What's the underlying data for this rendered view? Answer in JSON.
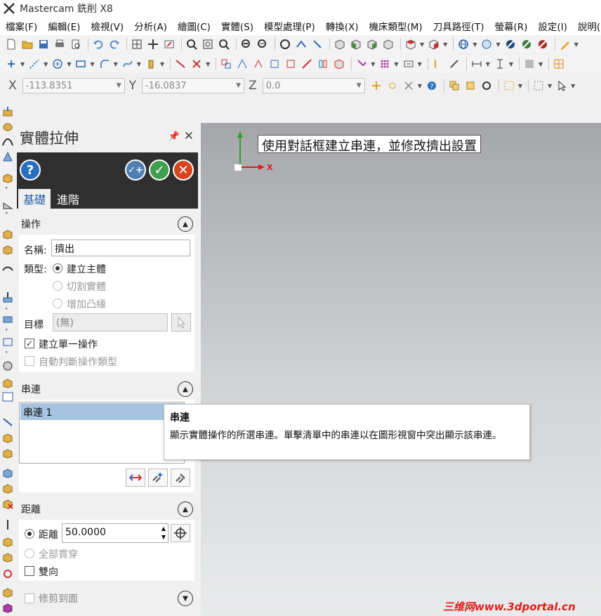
{
  "window": {
    "title": "Mastercam 銑削 X8"
  },
  "menu": [
    "檔案(F)",
    "編輯(E)",
    "檢視(V)",
    "分析(A)",
    "繪圖(C)",
    "實體(S)",
    "模型處理(P)",
    "轉換(X)",
    "機床類型(M)",
    "刀具路徑(T)",
    "螢幕(R)",
    "設定(I)",
    "說明(H)"
  ],
  "coords": {
    "x_label": "X",
    "x_value": "-113.8351",
    "y_label": "Y",
    "y_value": "-16.0837",
    "z_label": "Z",
    "z_value": "0.0"
  },
  "panel": {
    "title": "實體拉伸",
    "tabs": {
      "basic": "基礎",
      "advanced": "進階"
    },
    "operation": {
      "title": "操作",
      "name_label": "名稱:",
      "name_value": "擠出",
      "type_label": "類型:",
      "type_options": [
        "建立主體",
        "切割實體",
        "增加凸緣"
      ],
      "selected_type": "建立主體",
      "target_label": "目標",
      "target_value": "(無)",
      "single_op_label": "建立單一操作",
      "single_op_checked": true,
      "auto_detect_label": "自動判斷操作類型",
      "auto_detect_checked": false
    },
    "chaining": {
      "title": "串連",
      "items": [
        "串連  1"
      ]
    },
    "distance": {
      "title": "距離",
      "distance_label": "距離",
      "distance_value": "50.0000",
      "through_all_label": "全部貫穿",
      "both_directions_label": "雙向",
      "both_directions_checked": false
    },
    "trim": {
      "title": "修剪到面",
      "checked": false
    }
  },
  "viewport": {
    "hint": "使用對話框建立串連，並修改擠出設置",
    "axis_x_label": "X"
  },
  "tooltip": {
    "title": "串連",
    "body": "顯示實體操作的所選串連。單擊清單中的串連以在圖形視窗中突出顯示該串連。"
  },
  "watermark": "三维网www.3dportal.cn",
  "colors": {
    "accent_blue": "#2a6fbf",
    "ok_green": "#3f9f4f",
    "cancel_red": "#d8441e",
    "selected_row": "#a6c4df"
  }
}
